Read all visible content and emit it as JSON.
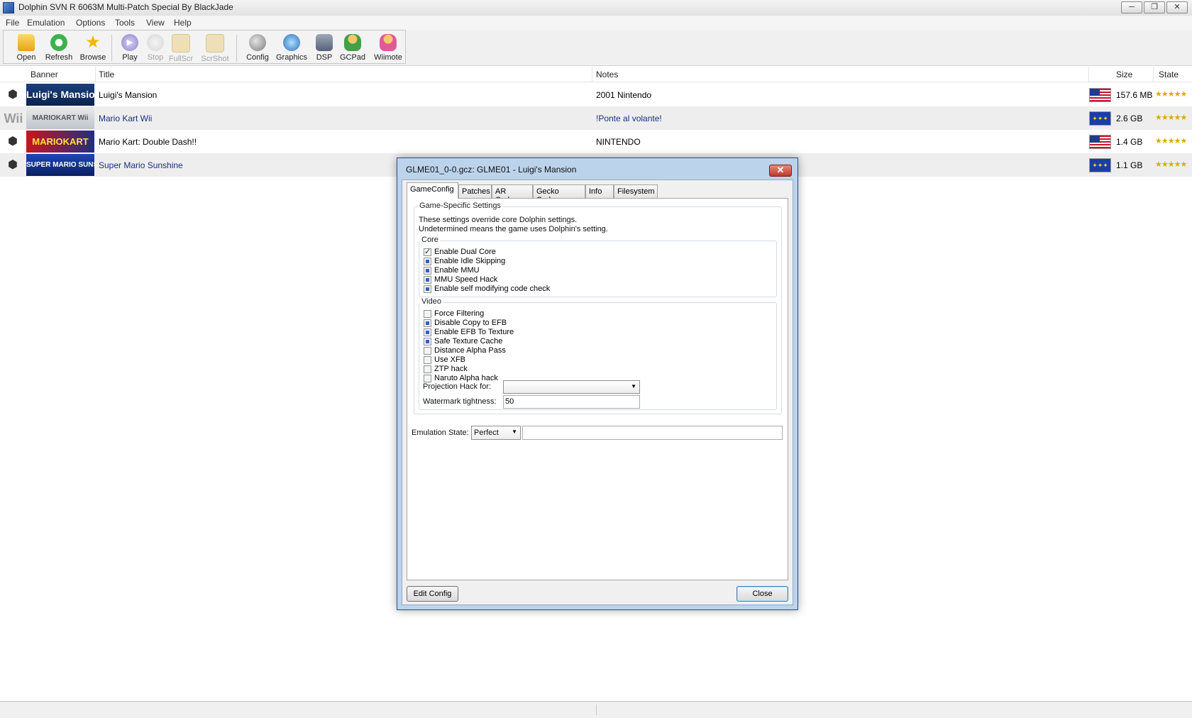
{
  "window": {
    "title": "Dolphin SVN R 6063M Multi-Patch Special By BlackJade",
    "buttons": {
      "minimize": "─",
      "maximize": "❐",
      "close": "✕"
    }
  },
  "menu": [
    "File",
    "Emulation",
    "Options",
    "Tools",
    "View",
    "Help"
  ],
  "toolbar": [
    {
      "label": "Open",
      "icon": "folder-icon",
      "enabled": true
    },
    {
      "label": "Refresh",
      "icon": "refresh-icon",
      "enabled": true
    },
    {
      "label": "Browse",
      "icon": "star-icon",
      "enabled": true
    },
    {
      "label": "Play",
      "icon": "play-icon",
      "enabled": true
    },
    {
      "label": "Stop",
      "icon": "stop-icon",
      "enabled": false
    },
    {
      "label": "FullScr",
      "icon": "fullscreen-icon",
      "enabled": false
    },
    {
      "label": "ScrShot",
      "icon": "screenshot-icon",
      "enabled": false
    },
    {
      "label": "Config",
      "icon": "wrench-icon",
      "enabled": true
    },
    {
      "label": "Graphics",
      "icon": "graphics-icon",
      "enabled": true
    },
    {
      "label": "DSP",
      "icon": "speaker-icon",
      "enabled": true
    },
    {
      "label": "GCPad",
      "icon": "gcpad-icon",
      "enabled": true
    },
    {
      "label": "Wiimote",
      "icon": "wiimote-icon",
      "enabled": true
    }
  ],
  "list": {
    "columns": {
      "banner": "Banner",
      "title": "Title",
      "notes": "Notes",
      "size": "Size",
      "state": "State"
    },
    "rows": [
      {
        "platform": "gamecube",
        "banner_text": "Luigi's Mansion",
        "title": "Luigi's Mansion",
        "notes": "2001 Nintendo",
        "region": "usa",
        "size": "157.6 MB",
        "stars": "★★★★★"
      },
      {
        "platform": "wii",
        "platform_label": "Wii",
        "banner_text": "MARIOKART Wii",
        "title": "Mario Kart Wii",
        "notes": "!Ponte al volante!",
        "region": "eu",
        "size": "2.6 GB",
        "stars": "★★★★★"
      },
      {
        "platform": "gamecube",
        "banner_text": "MARIOKART",
        "title": "Mario Kart: Double Dash!!",
        "notes": "NINTENDO",
        "region": "usa",
        "size": "1.4 GB",
        "stars": "★★★★★"
      },
      {
        "platform": "gamecube",
        "banner_text": "SUPER MARIO SUNSHINE",
        "title": "Super Mario Sunshine",
        "notes": "",
        "region": "eu",
        "size": "1.1 GB",
        "stars": "★★★★★"
      }
    ]
  },
  "dialog": {
    "title": "GLME01_0-0.gcz: GLME01 - Luigi's Mansion",
    "tabs": [
      "GameConfig",
      "Patches",
      "AR Codes",
      "Gecko Codes",
      "Info",
      "Filesystem"
    ],
    "group_title": "Game-Specific Settings",
    "desc_line1": "These settings override core Dolphin settings.",
    "desc_line2": "Undetermined means the game uses Dolphin's setting.",
    "core": {
      "label": "Core",
      "items": [
        {
          "label": "Enable Dual Core",
          "state": "checked"
        },
        {
          "label": "Enable Idle Skipping",
          "state": "indeterminate"
        },
        {
          "label": "Enable MMU",
          "state": "indeterminate"
        },
        {
          "label": "MMU Speed Hack",
          "state": "indeterminate"
        },
        {
          "label": "Enable self modifying code check",
          "state": "indeterminate"
        }
      ]
    },
    "video": {
      "label": "Video",
      "items": [
        {
          "label": "Force Filtering",
          "state": "unchecked"
        },
        {
          "label": "Disable Copy to EFB",
          "state": "indeterminate"
        },
        {
          "label": "Enable EFB To Texture",
          "state": "indeterminate"
        },
        {
          "label": "Safe Texture Cache",
          "state": "indeterminate"
        },
        {
          "label": "Distance Alpha Pass",
          "state": "unchecked"
        },
        {
          "label": "Use XFB",
          "state": "unchecked"
        },
        {
          "label": "ZTP hack",
          "state": "unchecked"
        },
        {
          "label": "Naruto Alpha hack",
          "state": "unchecked"
        }
      ],
      "projection_label": "Projection Hack for:",
      "projection_value": "",
      "watermark_label": "Watermark tightness:",
      "watermark_value": "50"
    },
    "emulation_state_label": "Emulation State:",
    "emulation_state_value": "Perfect",
    "emulation_state_notes": "",
    "edit_config": "Edit Config",
    "close": "Close"
  }
}
